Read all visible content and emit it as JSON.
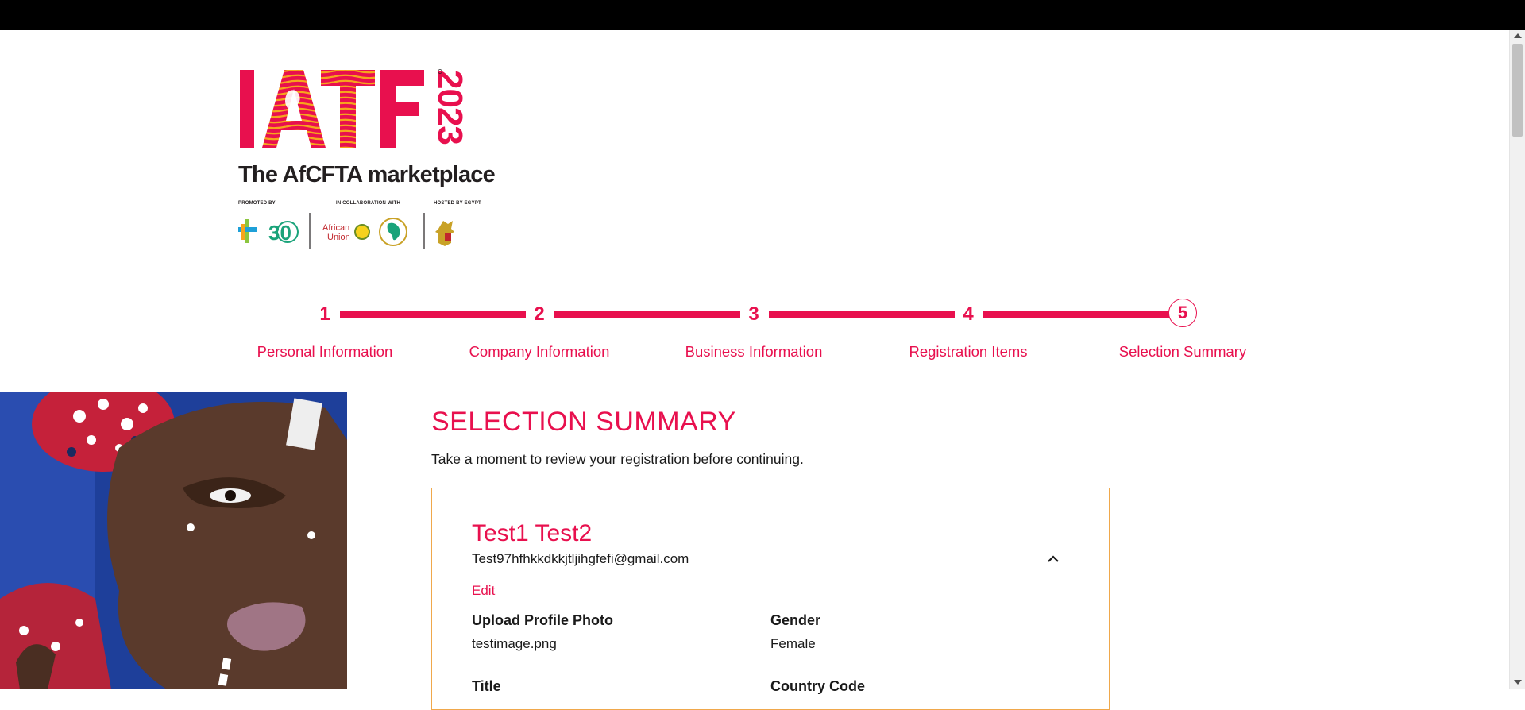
{
  "logo": {
    "main_letters": "IATF",
    "year": "2023",
    "tagline": "The AfCFTA marketplace",
    "promoted_by": "PROMOTED BY",
    "collaboration": "IN COLLABORATION WITH",
    "hosted_by": "HOSTED BY EGYPT",
    "african_union_line1": "African",
    "african_union_line2": "Union",
    "anniversary": "30",
    "registered_mark": "®"
  },
  "stepper": {
    "steps": [
      {
        "number": "1",
        "label": "Personal Information"
      },
      {
        "number": "2",
        "label": "Company Information"
      },
      {
        "number": "3",
        "label": "Business Information"
      },
      {
        "number": "4",
        "label": "Registration Items"
      },
      {
        "number": "5",
        "label": "Selection Summary"
      }
    ],
    "active_step": 5
  },
  "summary": {
    "title": "SELECTION SUMMARY",
    "intro": "Take a moment to review your registration before continuing."
  },
  "card": {
    "name": "Test1 Test2",
    "email": "Test97hfhkkdkkjtljihgfefi@gmail.com",
    "edit_label": "Edit",
    "fields": [
      {
        "label": "Upload Profile Photo",
        "value": "testimage.png"
      },
      {
        "label": "Gender",
        "value": "Female"
      },
      {
        "label": "Title",
        "value": ""
      },
      {
        "label": "Country Code",
        "value": ""
      }
    ]
  },
  "colors": {
    "brand": "#e8104e",
    "card_border": "#f0a84b",
    "topbar": "#000000"
  },
  "icons": {
    "collapse": "chevron-up-icon"
  }
}
